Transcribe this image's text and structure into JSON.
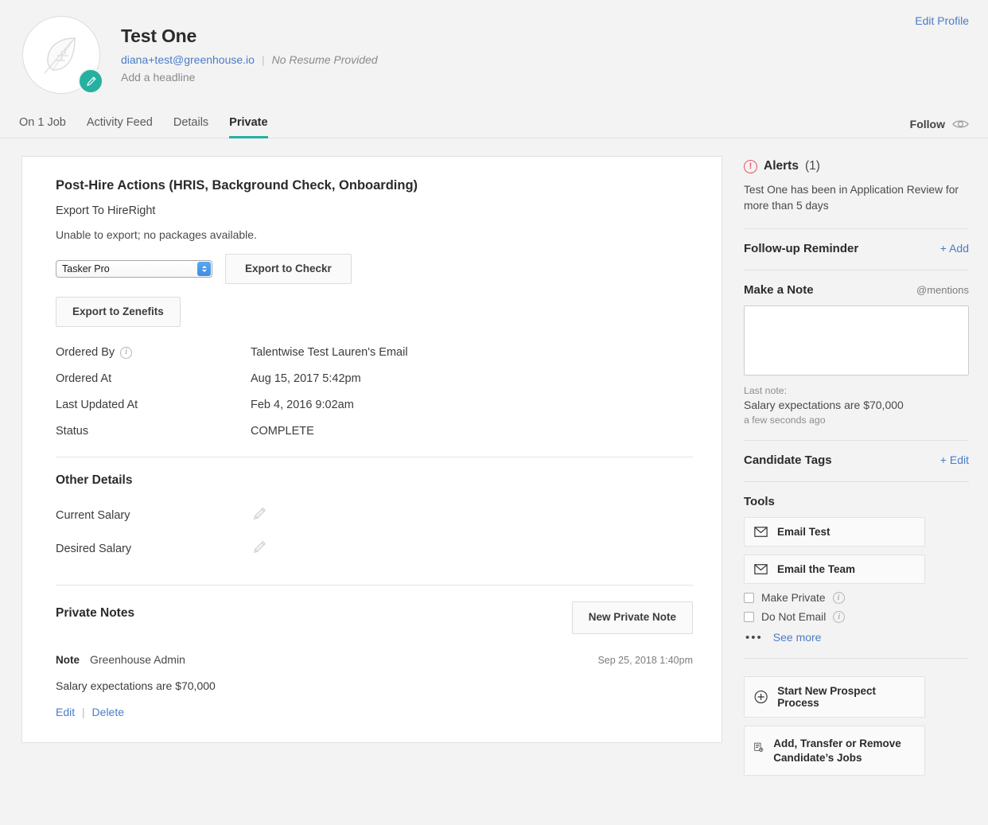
{
  "header": {
    "candidate_name": "Test One",
    "email": "diana+test@greenhouse.io",
    "separator": "|",
    "resume_status": "No Resume Provided",
    "headline_placeholder": "Add a headline",
    "edit_profile_label": "Edit Profile",
    "avatar_icon": "leaf-icon",
    "avatar_edit_icon": "pencil-icon"
  },
  "tabs": [
    {
      "label": "On 1 Job",
      "active": false
    },
    {
      "label": "Activity Feed",
      "active": false
    },
    {
      "label": "Details",
      "active": false
    },
    {
      "label": "Private",
      "active": true
    }
  ],
  "follow": {
    "label": "Follow",
    "icon": "eye-icon"
  },
  "main": {
    "section_title": "Post-Hire Actions (HRIS, Background Check, Onboarding)",
    "export_to_hireright": "Export To HireRight",
    "unable_message": "Unable to export; no packages available.",
    "package_select": {
      "value": "Tasker Pro",
      "options": [
        "Tasker Pro"
      ]
    },
    "export_checkr_label": "Export to Checkr",
    "export_zenefits_label": "Export to Zenefits",
    "details": [
      {
        "label": "Ordered By",
        "info": true,
        "value": "Talentwise Test Lauren's Email"
      },
      {
        "label": "Ordered At",
        "info": false,
        "value": "Aug 15, 2017 5:42pm"
      },
      {
        "label": "Last Updated At",
        "info": false,
        "value": "Feb 4, 2016 9:02am"
      },
      {
        "label": "Status",
        "info": false,
        "value": "COMPLETE"
      }
    ],
    "other_details_title": "Other Details",
    "salary_rows": [
      {
        "label": "Current Salary",
        "value": ""
      },
      {
        "label": "Desired Salary",
        "value": ""
      }
    ],
    "private_notes": {
      "title": "Private Notes",
      "new_note_label": "New Private Note",
      "note": {
        "kind": "Note",
        "author": "Greenhouse Admin",
        "timestamp": "Sep 25, 2018 1:40pm",
        "body": "Salary expectations are $70,000",
        "edit_label": "Edit",
        "separator": "|",
        "delete_label": "Delete"
      }
    }
  },
  "sidebar": {
    "alerts": {
      "title": "Alerts",
      "count": "(1)",
      "message": "Test One has been in Application Review for more than 5 days"
    },
    "follow_up": {
      "title": "Follow-up Reminder",
      "add_label": "+ Add"
    },
    "make_note": {
      "title": "Make a Note",
      "mentions_label": "@mentions",
      "textarea_value": "",
      "textarea_placeholder": "",
      "last_note_label": "Last note:",
      "last_note_text": "Salary expectations are $70,000",
      "last_note_time": "a few seconds ago"
    },
    "candidate_tags": {
      "title": "Candidate Tags",
      "edit_label": "+ Edit"
    },
    "tools": {
      "title": "Tools",
      "buttons": [
        {
          "label": "Email Test",
          "icon": "envelope-icon"
        },
        {
          "label": "Email the Team",
          "icon": "envelope-icon"
        }
      ],
      "checkboxes": [
        {
          "label": "Make Private",
          "checked": false
        },
        {
          "label": "Do Not Email",
          "checked": false
        }
      ],
      "see_more_label": "See more"
    },
    "bottom_actions": [
      {
        "label": "Start New Prospect Process",
        "icon": "plus-circle-icon"
      },
      {
        "label": "Add, Transfer or Remove Candidate’s Jobs",
        "icon": "jobs-gear-icon"
      }
    ]
  },
  "colors": {
    "accent_teal": "#25b0a0",
    "link_blue": "#4a7cc7",
    "alert_red": "#e8546a",
    "page_bg": "#f3f3f3"
  }
}
